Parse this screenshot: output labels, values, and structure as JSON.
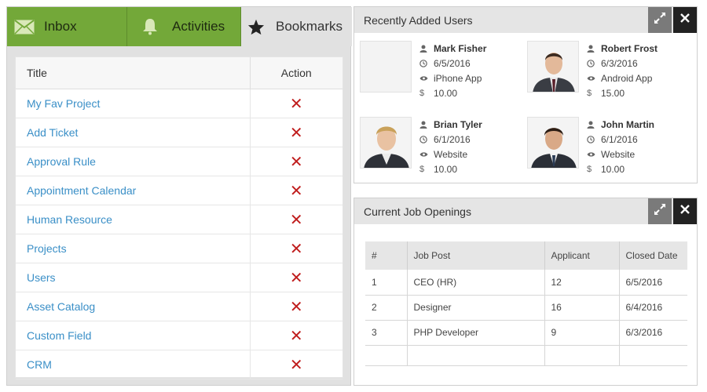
{
  "tabs": [
    {
      "label": "Inbox",
      "icon": "envelope-icon"
    },
    {
      "label": "Activities",
      "icon": "bell-icon"
    },
    {
      "label": "Bookmarks",
      "icon": "star-icon"
    }
  ],
  "bookmarks": {
    "col_title": "Title",
    "col_action": "Action",
    "rows": [
      {
        "title": "My Fav Project"
      },
      {
        "title": "Add Ticket"
      },
      {
        "title": "Approval Rule"
      },
      {
        "title": "Appointment Calendar"
      },
      {
        "title": "Human Resource"
      },
      {
        "title": "Projects"
      },
      {
        "title": "Users"
      },
      {
        "title": "Asset Catalog"
      },
      {
        "title": "Custom Field"
      },
      {
        "title": "CRM"
      }
    ],
    "delete_glyph": "✕"
  },
  "recent_users": {
    "title": "Recently Added Users",
    "users": [
      {
        "name": "Mark Fisher",
        "date": "6/5/2016",
        "source": "iPhone App",
        "amount": "10.00"
      },
      {
        "name": "Robert Frost",
        "date": "6/3/2016",
        "source": "Android App",
        "amount": "15.00"
      },
      {
        "name": "Brian Tyler",
        "date": "6/1/2016",
        "source": "Website",
        "amount": "10.00"
      },
      {
        "name": "John Martin",
        "date": "6/1/2016",
        "source": "Website",
        "amount": "10.00"
      }
    ]
  },
  "job_openings": {
    "title": "Current Job Openings",
    "headers": [
      "#",
      "Job Post",
      "Applicant",
      "Closed Date"
    ],
    "rows": [
      {
        "num": "1",
        "post": "CEO (HR)",
        "applicant": "12",
        "closed": "6/5/2016"
      },
      {
        "num": "2",
        "post": "Designer",
        "applicant": "16",
        "closed": "6/4/2016"
      },
      {
        "num": "3",
        "post": "PHP Developer",
        "applicant": "9",
        "closed": "6/3/2016"
      }
    ]
  },
  "colors": {
    "tab_green": "#73a839",
    "link_blue": "#3a8fc7",
    "delete_red": "#c01d1d",
    "close_dark": "#222222",
    "expand_gray": "#7a7a7a"
  }
}
